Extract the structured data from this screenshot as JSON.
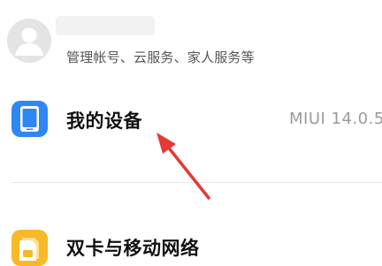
{
  "account": {
    "subtitle": "管理帐号、云服务、家人服务等",
    "avatar_icon": "person-icon"
  },
  "device": {
    "label": "我的设备",
    "value": "MIUI 14.0.5",
    "icon": "phone-icon",
    "icon_color": "#2f86f5"
  },
  "sim": {
    "label": "双卡与移动网络",
    "icon": "sim-card-icon",
    "icon_color": "#f7b928"
  },
  "annotation": {
    "arrow_color": "#e53935"
  }
}
